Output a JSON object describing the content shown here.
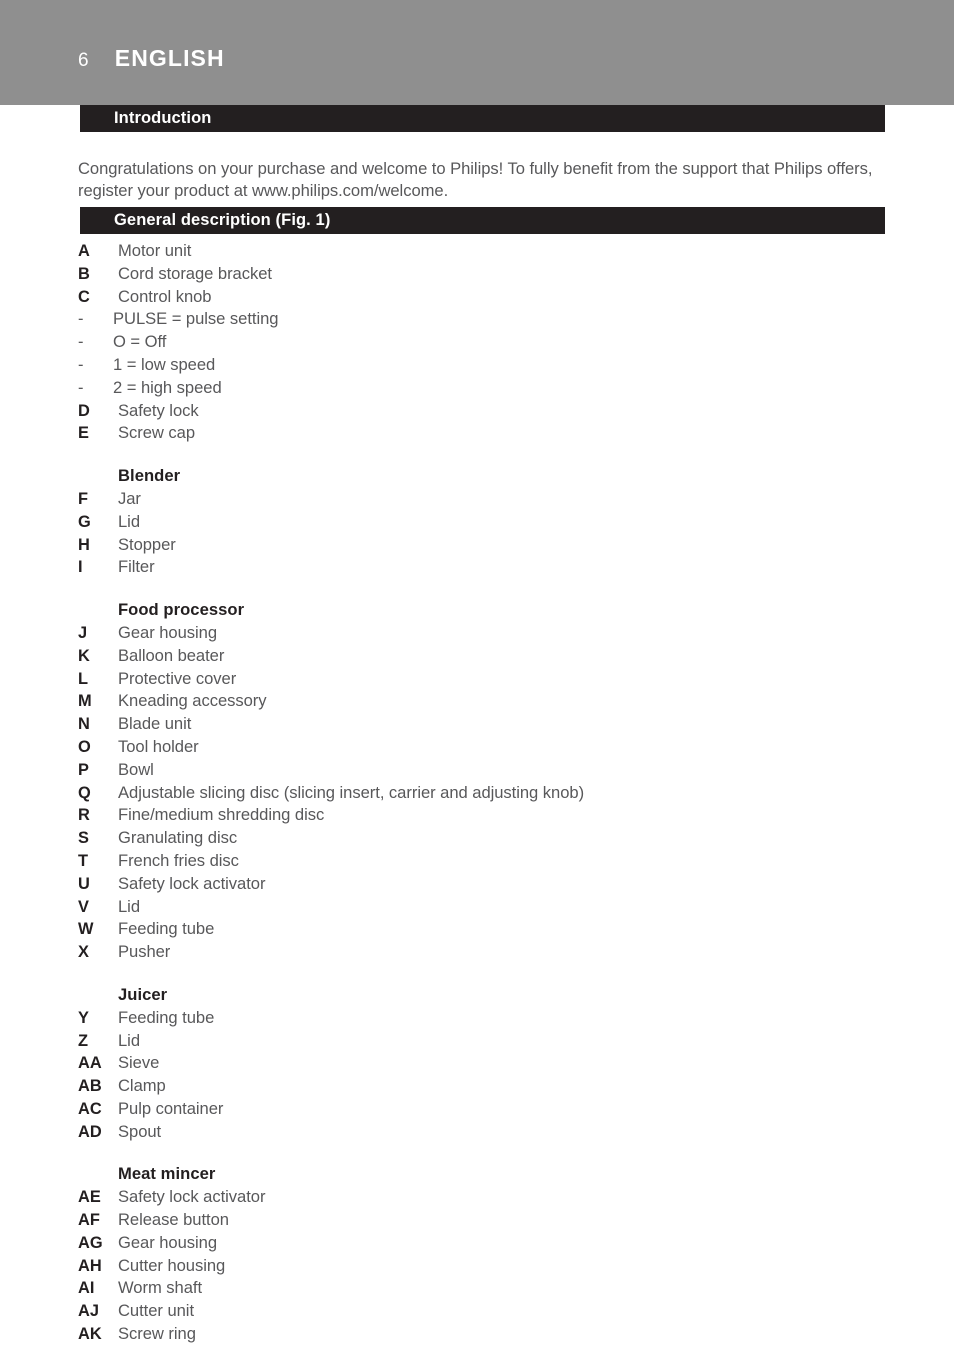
{
  "header": {
    "page_number": "6",
    "section_title": "ENGLISH",
    "band_color": "#8f8f8f"
  },
  "headings": {
    "introduction": "Introduction",
    "general_description": "General description (Fig. 1)",
    "bar_color": "#231f20"
  },
  "intro": {
    "paragraph": "Congratulations on your purchase and welcome to Philips! To fully benefit from the support that Philips offers, register your product at www.philips.com/welcome."
  },
  "parts": {
    "main": [
      {
        "key": "A",
        "value": "Motor unit"
      },
      {
        "key": "B",
        "value": "Cord storage bracket"
      },
      {
        "key": "C",
        "value": "Control knob"
      },
      {
        "key": "-",
        "value": "PULSE = pulse setting"
      },
      {
        "key": "-",
        "value": "O = Off"
      },
      {
        "key": "-",
        "value": "1 = low speed"
      },
      {
        "key": "-",
        "value": "2 = high speed"
      },
      {
        "key": "D",
        "value": "Safety lock"
      },
      {
        "key": "E",
        "value": "Screw cap"
      }
    ],
    "blender_heading": "Blender",
    "blender": [
      {
        "key": "F",
        "value": "Jar"
      },
      {
        "key": "G",
        "value": "Lid"
      },
      {
        "key": "H",
        "value": "Stopper"
      },
      {
        "key": "I",
        "value": "Filter"
      }
    ],
    "food_processor_heading": "Food processor",
    "food_processor": [
      {
        "key": "J",
        "value": "Gear housing"
      },
      {
        "key": "K",
        "value": "Balloon beater"
      },
      {
        "key": "L",
        "value": "Protective cover"
      },
      {
        "key": "M",
        "value": "Kneading accessory"
      },
      {
        "key": "N",
        "value": "Blade unit"
      },
      {
        "key": "O",
        "value": "Tool holder"
      },
      {
        "key": "P",
        "value": "Bowl"
      },
      {
        "key": "Q",
        "value": "Adjustable slicing disc (slicing insert, carrier and adjusting knob)"
      },
      {
        "key": "R",
        "value": "Fine/medium shredding disc"
      },
      {
        "key": "S",
        "value": "Granulating disc"
      },
      {
        "key": "T",
        "value": "French fries disc"
      },
      {
        "key": "U",
        "value": "Safety lock activator"
      },
      {
        "key": "V",
        "value": "Lid"
      },
      {
        "key": "W",
        "value": "Feeding tube"
      },
      {
        "key": "X",
        "value": "Pusher"
      }
    ],
    "juicer_heading": "Juicer",
    "juicer": [
      {
        "key": "Y",
        "value": "Feeding tube"
      },
      {
        "key": "Z",
        "value": "Lid"
      },
      {
        "key": "AA",
        "value": "Sieve"
      },
      {
        "key": "AB",
        "value": "Clamp"
      },
      {
        "key": "AC",
        "value": "Pulp container"
      },
      {
        "key": "AD",
        "value": "Spout"
      }
    ],
    "meat_mincer_heading": "Meat mincer",
    "meat_mincer": [
      {
        "key": "AE",
        "value": "Safety lock activator"
      },
      {
        "key": "AF",
        "value": "Release button"
      },
      {
        "key": "AG",
        "value": "Gear housing"
      },
      {
        "key": "AH",
        "value": "Cutter housing"
      },
      {
        "key": "AI",
        "value": "Worm shaft"
      },
      {
        "key": "AJ",
        "value": "Cutter unit"
      },
      {
        "key": "AK",
        "value": "Screw ring"
      }
    ]
  }
}
